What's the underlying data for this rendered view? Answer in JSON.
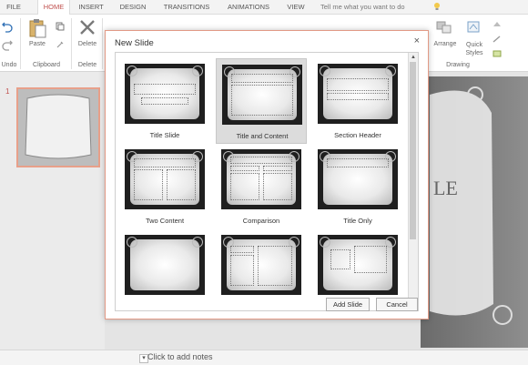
{
  "ribbon": {
    "tabs": [
      "FILE",
      "HOME",
      "INSERT",
      "DESIGN",
      "TRANSITIONS",
      "ANIMATIONS",
      "VIEW"
    ],
    "active_tab": "HOME",
    "tell_me": "Tell me what you want to do",
    "groups": {
      "undo": "Undo",
      "clipboard": "Clipboard",
      "delete": "Delete",
      "paste": "Paste",
      "delete_btn": "Delete",
      "arrange": "Arrange",
      "quick_styles": "Quick Styles",
      "drawing": "Drawing"
    }
  },
  "slides_pane": {
    "slide_number": "1"
  },
  "notes": {
    "placeholder": "Click to add notes"
  },
  "dialog": {
    "title": "New Slide",
    "close": "×",
    "layouts": [
      {
        "name": "Title Slide",
        "selected": false
      },
      {
        "name": "Title and Content",
        "selected": true
      },
      {
        "name": "Section Header",
        "selected": false
      },
      {
        "name": "Two Content",
        "selected": false
      },
      {
        "name": "Comparison",
        "selected": false
      },
      {
        "name": "Title Only",
        "selected": false
      },
      {
        "name": "",
        "selected": false
      },
      {
        "name": "",
        "selected": false
      },
      {
        "name": "",
        "selected": false
      }
    ],
    "add_button": "Add Slide",
    "cancel_button": "Cancel"
  },
  "colors": {
    "accent": "#c0504d",
    "dialog_border": "#e29a86"
  }
}
